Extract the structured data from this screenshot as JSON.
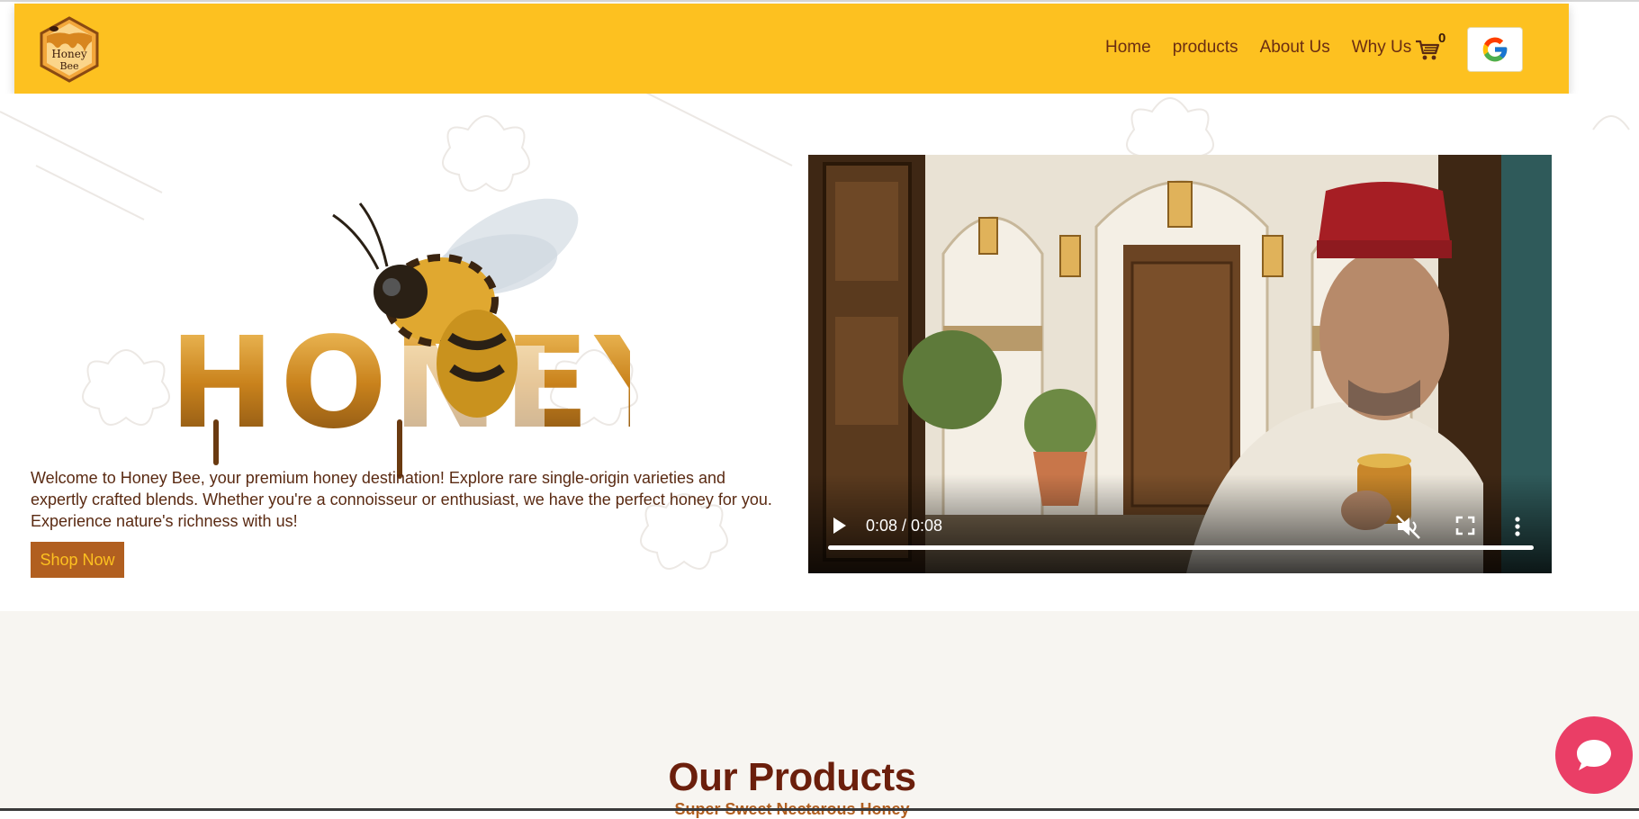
{
  "brand": {
    "logo_text_line1": "Honey",
    "logo_text_line2": "Bee"
  },
  "nav": {
    "items": [
      {
        "label": "Home"
      },
      {
        "label": "products"
      },
      {
        "label": "About Us"
      },
      {
        "label": "Why Us"
      }
    ],
    "cart_count": "0",
    "cart_icon": "cart-icon",
    "login_icon": "google-icon"
  },
  "hero": {
    "art_word": "HONEY",
    "description": "Welcome to Honey Bee, your premium honey destination! Explore rare single-origin varieties and expertly crafted blends. Whether you're a connoisseur or enthusiast, we have the perfect honey for you. Experience nature's richness with us!",
    "shop_button": "Shop Now"
  },
  "video": {
    "time": "0:08 / 0:08",
    "progress": 1.0,
    "muted": true
  },
  "products": {
    "title": "Our Products",
    "subtitle": "Super Sweet Nectarous Honey"
  },
  "colors": {
    "navbar": "#fdc120",
    "brand_brown": "#6b1f0c",
    "button_bg": "#b15f20",
    "chat": "#ea3e66"
  }
}
